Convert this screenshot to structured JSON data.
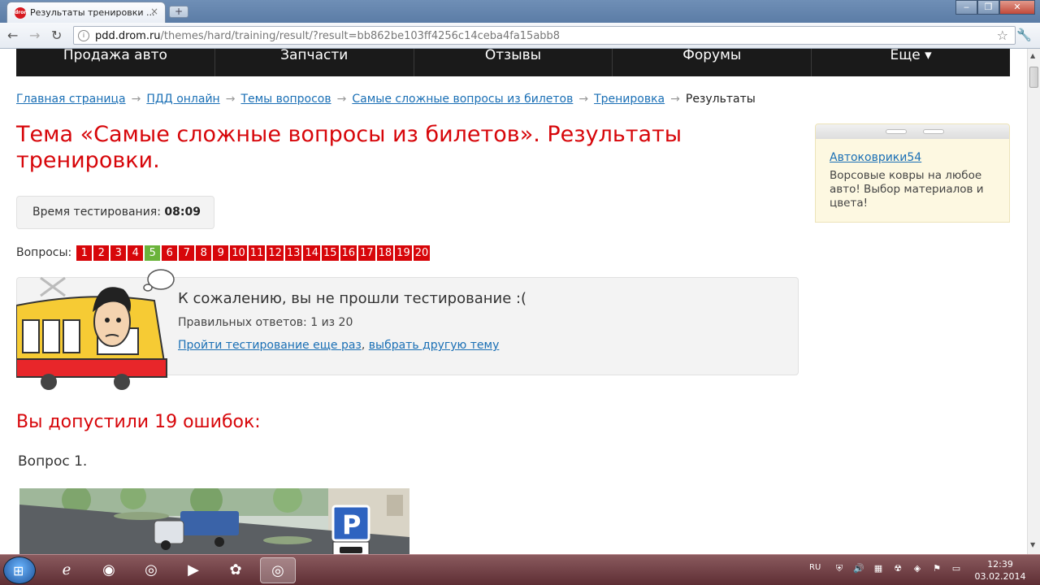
{
  "browser": {
    "tab_title": "Результаты тренировки ...",
    "tab_close": "×",
    "new_tab": "+",
    "url_host": "pdd.drom.ru",
    "url_path": "/themes/hard/training/result/?result=bb862be103ff4256c14ceba4fa15abb8"
  },
  "topnav": {
    "items": [
      "Продажа авто",
      "Запчасти",
      "Отзывы",
      "Форумы",
      "Еще ▾"
    ]
  },
  "breadcrumbs": {
    "items": [
      "Главная страница",
      "ПДД онлайн",
      "Темы вопросов",
      "Самые сложные вопросы из билетов",
      "Тренировка"
    ],
    "current": "Результаты",
    "separator": "→"
  },
  "page": {
    "title": "Тема «Самые сложные вопросы из билетов». Результаты тренировки.",
    "time_label": "Время тестирования:",
    "time_value": "08:09",
    "questions_label": "Вопросы:",
    "questions": [
      {
        "n": "1",
        "correct": false
      },
      {
        "n": "2",
        "correct": false
      },
      {
        "n": "3",
        "correct": false
      },
      {
        "n": "4",
        "correct": false
      },
      {
        "n": "5",
        "correct": true
      },
      {
        "n": "6",
        "correct": false
      },
      {
        "n": "7",
        "correct": false
      },
      {
        "n": "8",
        "correct": false
      },
      {
        "n": "9",
        "correct": false
      },
      {
        "n": "10",
        "correct": false
      },
      {
        "n": "11",
        "correct": false
      },
      {
        "n": "12",
        "correct": false
      },
      {
        "n": "13",
        "correct": false
      },
      {
        "n": "14",
        "correct": false
      },
      {
        "n": "15",
        "correct": false
      },
      {
        "n": "16",
        "correct": false
      },
      {
        "n": "17",
        "correct": false
      },
      {
        "n": "18",
        "correct": false
      },
      {
        "n": "19",
        "correct": false
      },
      {
        "n": "20",
        "correct": false
      }
    ],
    "result_title": "К сожалению, вы не прошли тестирование :(",
    "result_count": "Правильных ответов: 1 из 20",
    "retry_link": "Пройти тестирование еще раз",
    "separator": ", ",
    "other_topic_link": "выбрать другую тему",
    "errors_heading": "Вы допустили 19 ошибок:",
    "question_heading": "Вопрос 1."
  },
  "ad": {
    "link": "Автоковрики54",
    "text": "Ворсовые ковры на любое авто! Выбор материалов и цвета!"
  },
  "taskbar": {
    "lang": "RU",
    "time": "12:39",
    "date": "03.02.2014"
  },
  "colors": {
    "accent_red": "#d7060a",
    "correct_green": "#6bb33b",
    "link_blue": "#1a6fb5"
  }
}
